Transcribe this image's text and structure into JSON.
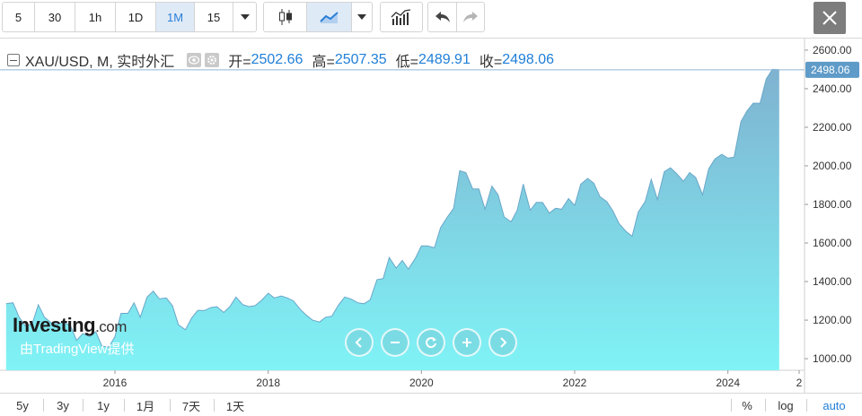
{
  "toolbar": {
    "intervals": [
      "5",
      "30",
      "1h",
      "1D",
      "1M",
      "15"
    ],
    "active_interval": "1M",
    "icons": [
      "candles-icon",
      "area-chart-icon",
      "dropdown-icon",
      "indicators-icon",
      "undo-icon",
      "redo-icon",
      "close-icon"
    ]
  },
  "legend": {
    "symbol": "XAU/USD, M, 实时外汇",
    "open_label": "开=",
    "open": "2502.66",
    "high_label": "高=",
    "high": "2507.35",
    "low_label": "低=",
    "low": "2489.91",
    "close_label": "收=",
    "close": "2498.06"
  },
  "watermark": {
    "logo": "Investing",
    "logo_suffix": ".com",
    "provider": "由TradingView提供"
  },
  "bottom": {
    "ranges": [
      "5y",
      "3y",
      "1y",
      "1月",
      "7天",
      "1天"
    ],
    "percent": "%",
    "log": "log",
    "auto": "auto"
  },
  "colors": {
    "accent": "#1f7fd8",
    "area_top": "#7fb2d0",
    "area_bottom": "#7ff3f6",
    "price_tag": "#5f9bc8"
  },
  "chart_data": {
    "type": "area",
    "title": "XAU/USD, M, 实时外汇",
    "xlabel": "",
    "ylabel": "",
    "x_ticks": [
      "2016",
      "2018",
      "2020",
      "2022",
      "2024",
      "2"
    ],
    "y_ticks": [
      "1000.00",
      "1200.00",
      "1400.00",
      "1600.00",
      "1800.00",
      "2000.00",
      "2200.00",
      "2400.00",
      "2600.00"
    ],
    "ylim": [
      940,
      2660
    ],
    "xlim": [
      2014.5,
      2025.0
    ],
    "last_price_label": "2498.06",
    "last_price": 2498.06,
    "grid": false,
    "x": [
      2014.58,
      2014.67,
      2014.75,
      2014.83,
      2014.92,
      2015.0,
      2015.08,
      2015.17,
      2015.25,
      2015.33,
      2015.42,
      2015.5,
      2015.58,
      2015.67,
      2015.75,
      2015.83,
      2015.92,
      2016.0,
      2016.08,
      2016.17,
      2016.25,
      2016.33,
      2016.42,
      2016.5,
      2016.58,
      2016.67,
      2016.75,
      2016.83,
      2016.92,
      2017.0,
      2017.08,
      2017.17,
      2017.25,
      2017.33,
      2017.42,
      2017.5,
      2017.58,
      2017.67,
      2017.75,
      2017.83,
      2017.92,
      2018.0,
      2018.08,
      2018.17,
      2018.25,
      2018.33,
      2018.42,
      2018.5,
      2018.58,
      2018.67,
      2018.75,
      2018.83,
      2018.92,
      2019.0,
      2019.08,
      2019.17,
      2019.25,
      2019.33,
      2019.42,
      2019.5,
      2019.58,
      2019.67,
      2019.75,
      2019.83,
      2019.92,
      2020.0,
      2020.08,
      2020.17,
      2020.25,
      2020.33,
      2020.42,
      2020.5,
      2020.58,
      2020.67,
      2020.75,
      2020.83,
      2020.92,
      2021.0,
      2021.08,
      2021.17,
      2021.25,
      2021.33,
      2021.42,
      2021.5,
      2021.58,
      2021.67,
      2021.75,
      2021.83,
      2021.92,
      2022.0,
      2022.08,
      2022.17,
      2022.25,
      2022.33,
      2022.42,
      2022.5,
      2022.58,
      2022.67,
      2022.75,
      2022.83,
      2022.92,
      2023.0,
      2023.08,
      2023.17,
      2023.25,
      2023.33,
      2023.42,
      2023.5,
      2023.58,
      2023.67,
      2023.75,
      2023.83,
      2023.92,
      2024.0,
      2024.08,
      2024.17,
      2024.25,
      2024.33,
      2024.42,
      2024.5,
      2024.58,
      2024.67
    ],
    "values": [
      1285,
      1290,
      1215,
      1170,
      1180,
      1280,
      1215,
      1185,
      1180,
      1190,
      1170,
      1095,
      1130,
      1115,
      1140,
      1065,
      1060,
      1115,
      1235,
      1235,
      1290,
      1215,
      1320,
      1350,
      1310,
      1315,
      1275,
      1175,
      1150,
      1210,
      1250,
      1250,
      1265,
      1270,
      1240,
      1270,
      1320,
      1280,
      1270,
      1275,
      1305,
      1340,
      1315,
      1325,
      1315,
      1300,
      1255,
      1225,
      1200,
      1190,
      1215,
      1220,
      1280,
      1320,
      1310,
      1290,
      1285,
      1305,
      1410,
      1415,
      1525,
      1470,
      1510,
      1465,
      1520,
      1585,
      1585,
      1575,
      1680,
      1730,
      1780,
      1975,
      1965,
      1880,
      1880,
      1775,
      1895,
      1850,
      1735,
      1710,
      1770,
      1905,
      1770,
      1810,
      1810,
      1755,
      1780,
      1775,
      1830,
      1795,
      1905,
      1935,
      1910,
      1840,
      1815,
      1765,
      1700,
      1660,
      1635,
      1760,
      1815,
      1930,
      1825,
      1970,
      1990,
      1960,
      1920,
      1965,
      1940,
      1850,
      1985,
      2035,
      2060,
      2040,
      2045,
      2230,
      2285,
      2325,
      2325,
      2450,
      2500,
      2498
    ]
  }
}
